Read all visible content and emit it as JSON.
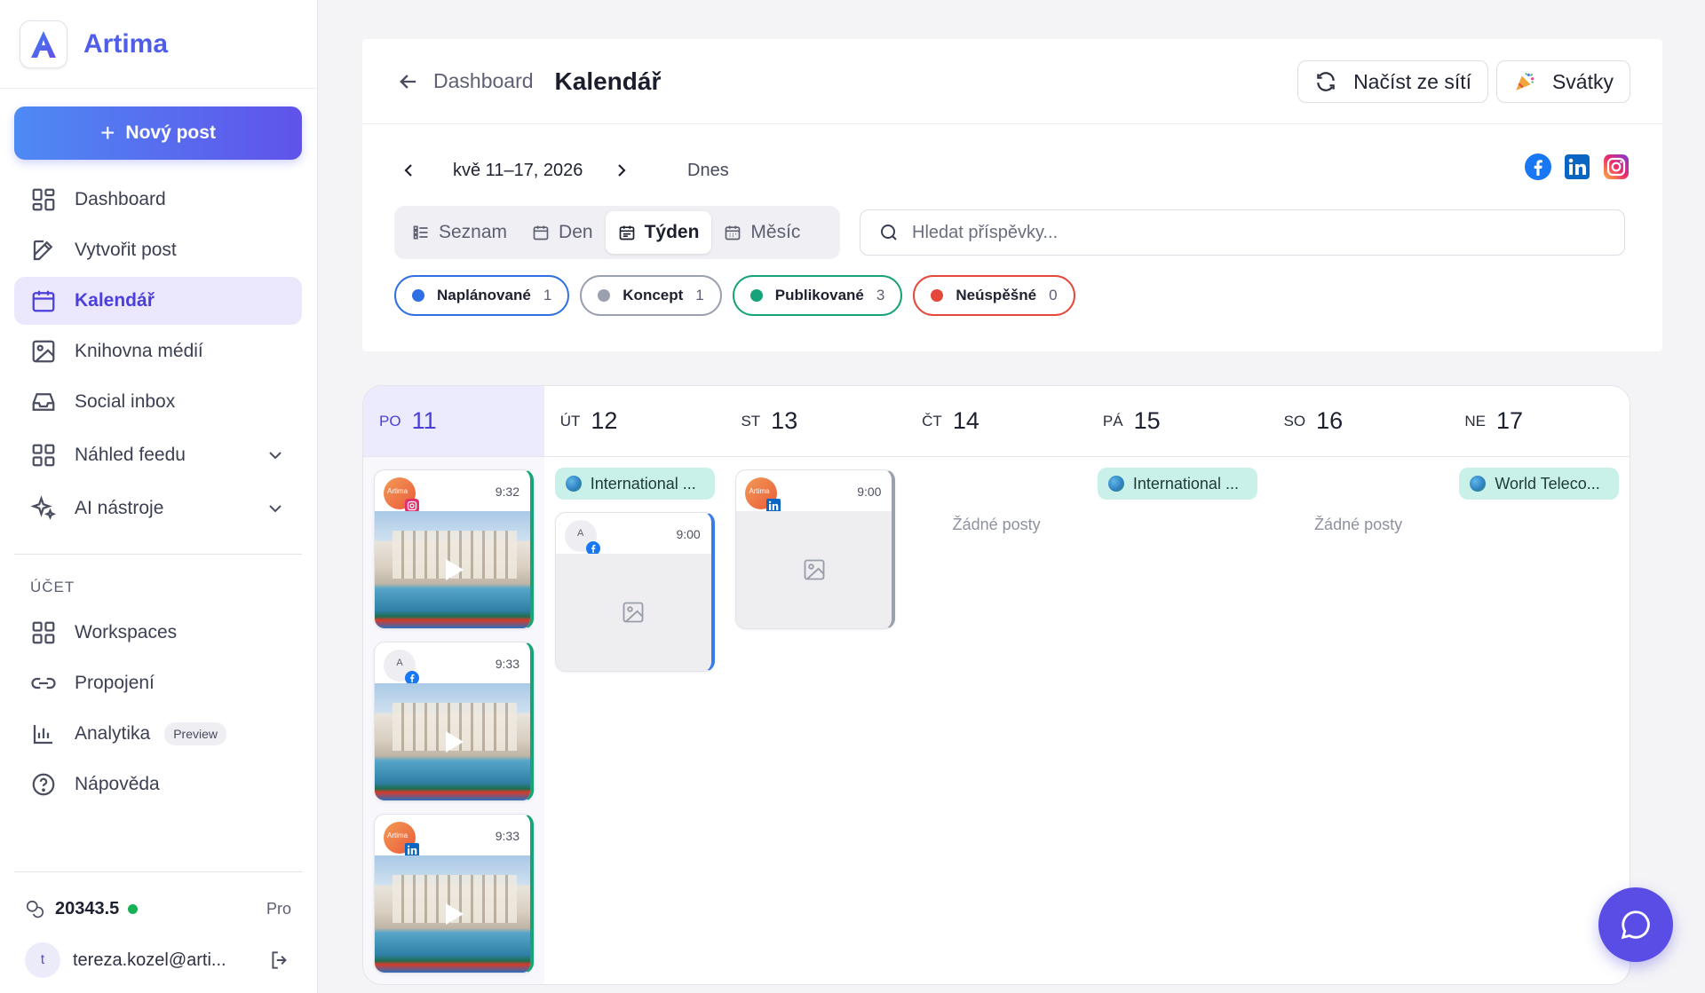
{
  "app": {
    "name": "Artima",
    "logo_letter": "A"
  },
  "sidebar": {
    "new_post_label": "Nový post",
    "items": [
      {
        "label": "Dashboard",
        "icon": "grid-icon"
      },
      {
        "label": "Vytvořit post",
        "icon": "edit-icon"
      },
      {
        "label": "Kalendář",
        "icon": "calendar-icon",
        "active": true
      },
      {
        "label": "Knihovna médií",
        "icon": "image-icon"
      },
      {
        "label": "Social inbox",
        "icon": "inbox-icon"
      },
      {
        "label": "Náhled feedu",
        "icon": "grid-icon",
        "expandable": true
      },
      {
        "label": "AI nástroje",
        "icon": "sparkles-icon",
        "expandable": true
      }
    ],
    "account_title": "ÚČET",
    "account_items": [
      {
        "label": "Workspaces",
        "icon": "grid-icon"
      },
      {
        "label": "Propojení",
        "icon": "link-icon"
      },
      {
        "label": "Analytika",
        "icon": "chart-icon",
        "badge": "Preview"
      },
      {
        "label": "Nápověda",
        "icon": "help-icon"
      }
    ],
    "credits": "20343.5",
    "plan": "Pro",
    "user_initial": "t",
    "user_email": "tereza.kozel@arti..."
  },
  "header": {
    "breadcrumb": "Dashboard",
    "title": "Kalendář",
    "load_button": "Načíst ze sítí",
    "holidays_button": "Svátky"
  },
  "toolbar": {
    "week_range": "kvě 11–17, 2026",
    "today_label": "Dnes",
    "views": [
      "Seznam",
      "Den",
      "Týden",
      "Měsíc"
    ],
    "active_view": "Týden",
    "search_placeholder": "Hledat příspěvky..."
  },
  "filters": [
    {
      "label": "Naplánované",
      "count": "1",
      "color": "#2f6fe4"
    },
    {
      "label": "Koncept",
      "count": "1",
      "color": "#9aa0ad"
    },
    {
      "label": "Publikované",
      "count": "3",
      "color": "#16a37a"
    },
    {
      "label": "Neúspěšné",
      "count": "0",
      "color": "#e5483a"
    }
  ],
  "calendar": {
    "days": [
      {
        "name": "PO",
        "date": "11",
        "today": true
      },
      {
        "name": "ÚT",
        "date": "12"
      },
      {
        "name": "ST",
        "date": "13"
      },
      {
        "name": "ČT",
        "date": "14"
      },
      {
        "name": "PÁ",
        "date": "15"
      },
      {
        "name": "SO",
        "date": "16"
      },
      {
        "name": "NE",
        "date": "17"
      }
    ],
    "empty_label": "Žádné posty",
    "posts": {
      "mon_1": {
        "time": "9:32",
        "network": "instagram",
        "avatar": "Artima"
      },
      "mon_2": {
        "time": "9:33",
        "network": "facebook",
        "avatar": "A"
      },
      "mon_3": {
        "time": "9:33",
        "network": "linkedin",
        "avatar": "Artima"
      },
      "tue_1": {
        "time": "9:00",
        "network": "facebook",
        "avatar": "A"
      },
      "wed_1": {
        "time": "9:00",
        "network": "linkedin",
        "avatar": "Artima"
      }
    },
    "holidays": {
      "tue": "International ...",
      "fri": "International ...",
      "sun": "World Teleco..."
    }
  },
  "colors": {
    "accent": "#4b3fdc",
    "published": "#17a673",
    "scheduled": "#3a7bea"
  }
}
